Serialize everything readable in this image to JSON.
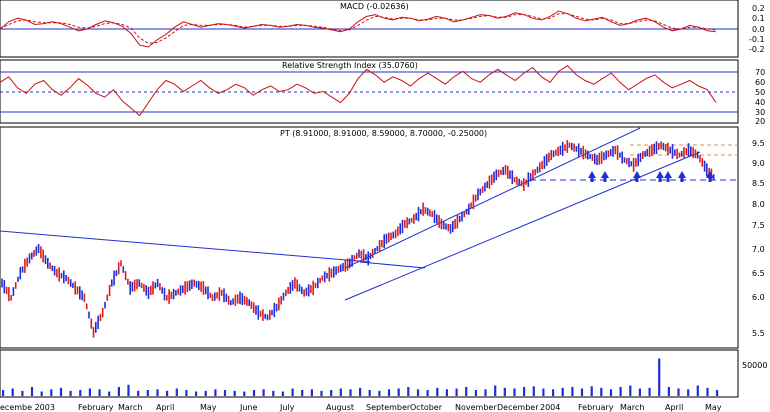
{
  "colors": {
    "up": "#1f2fd6",
    "down": "#e01a1a",
    "line": "#1f2fd6",
    "rsi": "#cc1111",
    "macd": "#cc1111",
    "frame": "#000000",
    "guide": "#e09050"
  },
  "chart_data": [
    {
      "type": "line",
      "title": "MACD (-0.02636)",
      "ylim": [
        -0.3,
        0.3
      ],
      "yticks": [
        "0.2",
        "0.1",
        "0.0",
        "-0.1",
        "-0.2"
      ],
      "series": [
        {
          "style": "solid",
          "values": [
            0.0,
            0.08,
            0.12,
            0.1,
            0.05,
            0.06,
            0.08,
            0.06,
            0.02,
            -0.02,
            0.0,
            0.05,
            0.09,
            0.07,
            0.03,
            -0.05,
            -0.18,
            -0.2,
            -0.12,
            -0.06,
            0.02,
            0.08,
            0.05,
            0.02,
            0.04,
            0.06,
            0.05,
            0.03,
            0.01,
            0.03,
            0.05,
            0.04,
            0.02,
            0.03,
            0.05,
            0.04,
            0.02,
            0.01,
            -0.01,
            -0.03,
            0.0,
            0.08,
            0.14,
            0.16,
            0.12,
            0.1,
            0.13,
            0.12,
            0.09,
            0.11,
            0.14,
            0.12,
            0.08,
            0.1,
            0.13,
            0.16,
            0.15,
            0.12,
            0.14,
            0.18,
            0.16,
            0.12,
            0.1,
            0.14,
            0.2,
            0.17,
            0.12,
            0.09,
            0.11,
            0.13,
            0.08,
            0.04,
            0.06,
            0.1,
            0.12,
            0.08,
            0.02,
            -0.02,
            0.0,
            0.04,
            0.02,
            -0.02,
            -0.03
          ]
        },
        {
          "style": "dashed",
          "values": [
            0.0,
            0.05,
            0.09,
            0.1,
            0.08,
            0.07,
            0.07,
            0.07,
            0.05,
            0.02,
            0.01,
            0.03,
            0.06,
            0.07,
            0.05,
            0.01,
            -0.1,
            -0.16,
            -0.15,
            -0.1,
            -0.03,
            0.04,
            0.05,
            0.04,
            0.04,
            0.05,
            0.05,
            0.04,
            0.02,
            0.03,
            0.04,
            0.04,
            0.03,
            0.03,
            0.04,
            0.04,
            0.03,
            0.02,
            0.0,
            -0.02,
            -0.01,
            0.04,
            0.1,
            0.14,
            0.13,
            0.11,
            0.12,
            0.12,
            0.1,
            0.1,
            0.12,
            0.12,
            0.1,
            0.1,
            0.12,
            0.14,
            0.15,
            0.13,
            0.13,
            0.16,
            0.16,
            0.14,
            0.11,
            0.12,
            0.17,
            0.17,
            0.14,
            0.11,
            0.1,
            0.12,
            0.1,
            0.06,
            0.06,
            0.08,
            0.1,
            0.09,
            0.05,
            0.01,
            0.0,
            0.02,
            0.02,
            0.0,
            -0.01
          ]
        }
      ]
    },
    {
      "type": "line",
      "title": "Relative Strength Index (35.0760)",
      "ylim": [
        15,
        80
      ],
      "yticks": [
        "70",
        "60",
        "50",
        "40",
        "30",
        "20"
      ],
      "reference_lines": [
        70,
        50,
        30
      ],
      "series": [
        {
          "style": "solid",
          "values": [
            58,
            64,
            52,
            46,
            56,
            60,
            50,
            44,
            52,
            62,
            55,
            46,
            42,
            50,
            38,
            30,
            22,
            36,
            50,
            60,
            56,
            48,
            54,
            60,
            52,
            46,
            50,
            56,
            52,
            44,
            50,
            54,
            48,
            50,
            56,
            52,
            46,
            48,
            42,
            36,
            46,
            62,
            72,
            66,
            58,
            64,
            60,
            54,
            62,
            68,
            62,
            56,
            64,
            70,
            62,
            58,
            66,
            72,
            66,
            60,
            68,
            74,
            64,
            58,
            70,
            76,
            66,
            60,
            56,
            62,
            68,
            58,
            50,
            56,
            62,
            66,
            58,
            52,
            56,
            60,
            54,
            50,
            36
          ]
        }
      ]
    },
    {
      "type": "line",
      "title": "PT (8.91000, 8.91000, 8.59000, 8.70000, -0.25000)",
      "ylim": [
        5.3,
        9.75
      ],
      "yticks": [
        "9.5",
        "9.0",
        "8.5",
        "8.0",
        "7.5",
        "7.0",
        "6.5",
        "6.0",
        "5.5"
      ],
      "x_labels": [
        "ecembe 2003",
        "February",
        "March",
        "April",
        "May",
        "June",
        "July",
        "August",
        "September",
        "October",
        "November",
        "December",
        "2004",
        "February",
        "March",
        "April",
        "May"
      ],
      "series": [
        {
          "name": "",
          "values": [
            6.6,
            6.3,
            6.8,
            7.1,
            7.3,
            7.0,
            6.8,
            6.7,
            6.5,
            6.3,
            5.6,
            6.0,
            6.6,
            7.0,
            6.5,
            6.6,
            6.4,
            6.6,
            6.3,
            6.4,
            6.5,
            6.6,
            6.5,
            6.3,
            6.4,
            6.2,
            6.3,
            6.2,
            6.0,
            5.9,
            6.1,
            6.4,
            6.6,
            6.4,
            6.5,
            6.7,
            6.8,
            6.9,
            7.0,
            7.2,
            7.1,
            7.3,
            7.5,
            7.6,
            7.8,
            7.9,
            8.1,
            8.0,
            7.8,
            7.7,
            7.9,
            8.1,
            8.4,
            8.6,
            8.8,
            8.9,
            8.7,
            8.6,
            8.8,
            9.0,
            9.2,
            9.3,
            9.4,
            9.3,
            9.2,
            9.1,
            9.2,
            9.3,
            9.1,
            9.0,
            9.2,
            9.3,
            9.4,
            9.3,
            9.2,
            9.3,
            9.2,
            8.9,
            8.7
          ]
        }
      ]
    },
    {
      "type": "bar",
      "title": "",
      "yticks": [
        "50000"
      ],
      "values": [
        8,
        10,
        7,
        12,
        6,
        9,
        11,
        7,
        8,
        10,
        9,
        6,
        12,
        15,
        7,
        8,
        9,
        7,
        10,
        8,
        6,
        7,
        9,
        8,
        7,
        6,
        8,
        9,
        7,
        6,
        10,
        8,
        9,
        7,
        8,
        10,
        9,
        11,
        8,
        7,
        9,
        10,
        12,
        9,
        8,
        11,
        9,
        10,
        12,
        8,
        9,
        14,
        11,
        10,
        12,
        13,
        10,
        9,
        11,
        12,
        10,
        13,
        11,
        9,
        12,
        14,
        10,
        11,
        50,
        12,
        10,
        9,
        14,
        11,
        8
      ]
    }
  ]
}
